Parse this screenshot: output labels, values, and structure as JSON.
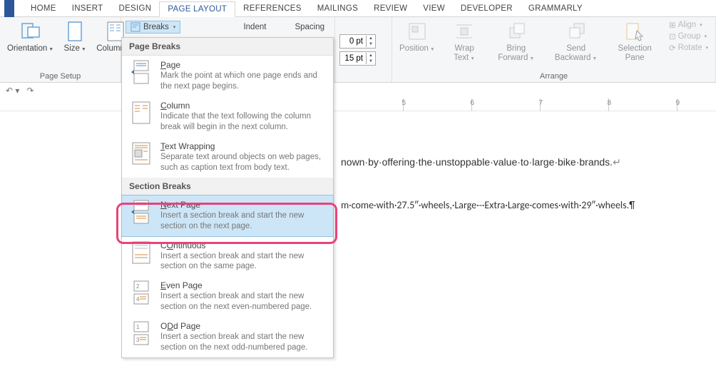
{
  "tabs": [
    "HOME",
    "INSERT",
    "DESIGN",
    "PAGE LAYOUT",
    "REFERENCES",
    "MAILINGS",
    "REVIEW",
    "VIEW",
    "DEVELOPER",
    "GRAMMARLY"
  ],
  "active_tab_index": 3,
  "ribbon": {
    "page_setup": {
      "orientation": "Orientation",
      "size": "Size",
      "columns": "Columns",
      "breaks": "Breaks",
      "group_label": "Page Setup"
    },
    "paragraph": {
      "indent_label": "Indent",
      "spacing_label": "Spacing",
      "spacing_before": "0 pt",
      "spacing_after": "15 pt"
    },
    "arrange": {
      "position": "Position",
      "wrap": "Wrap Text",
      "bring": "Bring Forward",
      "send": "Send Backward",
      "selection": "Selection Pane",
      "align": "Align",
      "group": "Group",
      "rotate": "Rotate",
      "group_label": "Arrange"
    }
  },
  "dropdown": {
    "section1": "Page Breaks",
    "section2": "Section Breaks",
    "items": [
      {
        "title": "Page",
        "accel": "P",
        "desc": "Mark the point at which one page ends and the next page begins."
      },
      {
        "title": "Column",
        "accel": "C",
        "desc": "Indicate that the text following the column break will begin in the next column."
      },
      {
        "title": "Text Wrapping",
        "accel": "T",
        "desc": "Separate text around objects on web pages, such as caption text from body text."
      },
      {
        "title": "Next Page",
        "accel": "N",
        "desc": "Insert a section break and start the new section on the next page."
      },
      {
        "title": "Continuous",
        "accel": "O",
        "desc": "Insert a section break and start the new section on the same page."
      },
      {
        "title": "Even Page",
        "accel": "E",
        "desc": "Insert a section break and start the new section on the next even-numbered page."
      },
      {
        "title": "Odd Page",
        "accel": "D",
        "desc": "Insert a section break and start the new section on the next odd-numbered page."
      }
    ]
  },
  "document": {
    "line1": "nown·by·offering·the·unstoppable·value·to·large·bike·brands.",
    "line2": "m·come·with·27.5″·wheels,·Large·-·Extra·Large·comes·with·29″·wheels.¶"
  },
  "ruler_numbers": [
    "5",
    "6",
    "7",
    "8",
    "9"
  ]
}
